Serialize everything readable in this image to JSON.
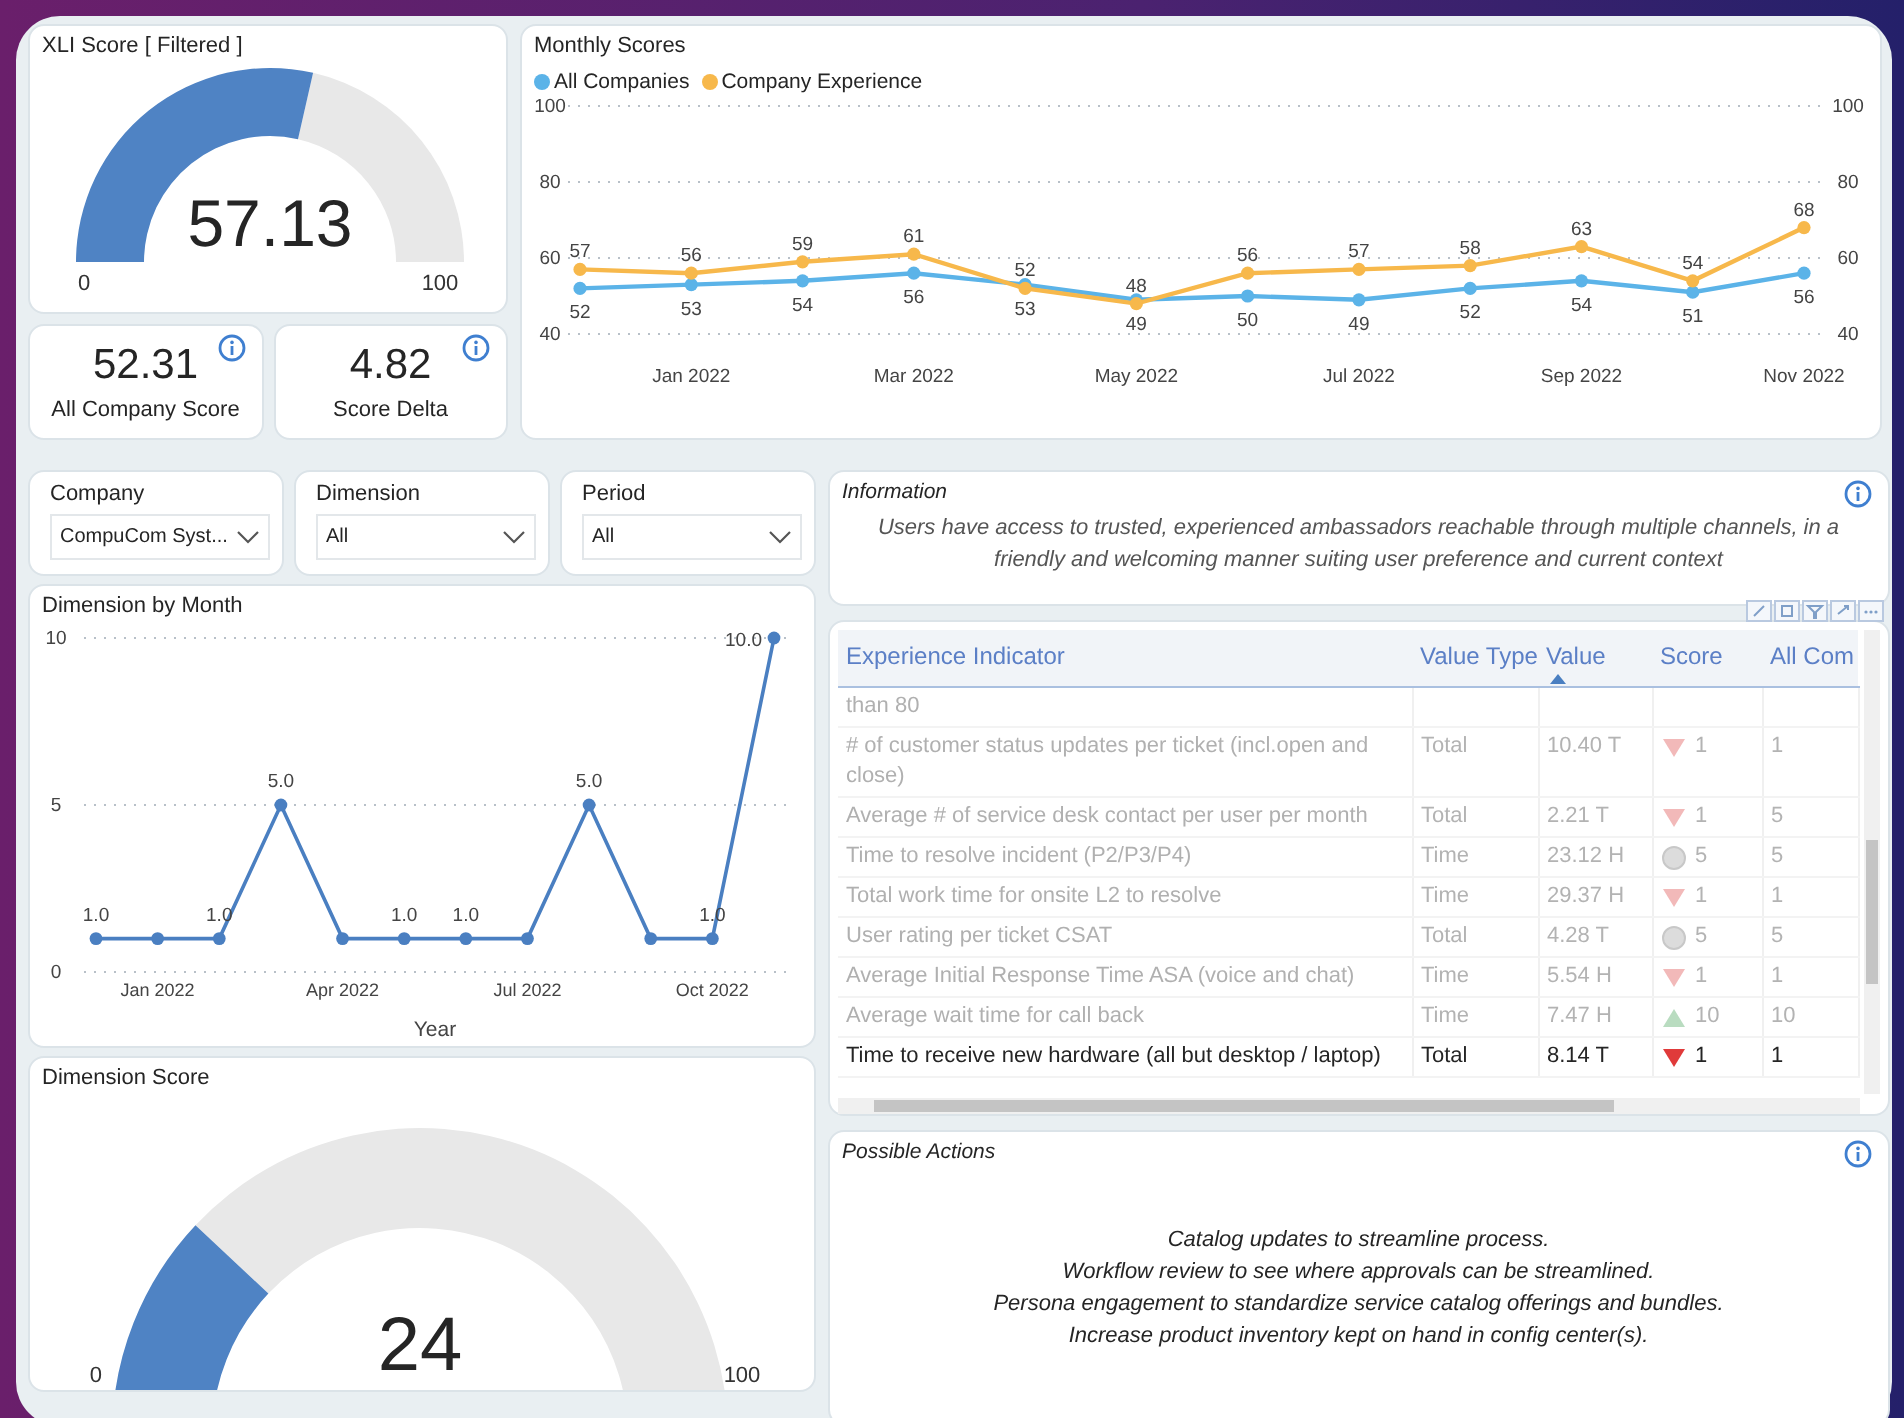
{
  "xli_gauge": {
    "title": "XLI Score [ Filtered ]",
    "value": "57.13",
    "level": 0.5713,
    "min": "0",
    "max": "100"
  },
  "kpis": [
    {
      "value": "52.31",
      "label": "All Company Score"
    },
    {
      "value": "4.82",
      "label": "Score Delta"
    }
  ],
  "monthly_scores": {
    "title": "Monthly Scores",
    "chart_data": {
      "type": "line",
      "categories": [
        null,
        "Jan 2022",
        null,
        "Mar 2022",
        null,
        "May 2022",
        null,
        "Jul 2022",
        null,
        "Sep 2022",
        null,
        "Nov 2022"
      ],
      "ylim": [
        40,
        100
      ],
      "yticks": [
        40,
        60,
        80,
        100
      ],
      "y2lim": [
        40,
        100
      ],
      "y2ticks": [
        40,
        60,
        80,
        100
      ],
      "data_labels": true,
      "series": [
        {
          "name": "All Companies",
          "color": "#5bb3e8",
          "marker": "circle",
          "values": [
            52,
            53,
            54,
            56,
            53,
            49,
            50,
            49,
            52,
            54,
            51,
            56
          ]
        },
        {
          "name": "Company Experience",
          "color": "#f7b84b",
          "marker": "circle",
          "values": [
            57,
            56,
            59,
            61,
            52,
            48,
            56,
            57,
            58,
            63,
            54,
            68
          ]
        }
      ]
    }
  },
  "filters": [
    {
      "label": "Company",
      "value": "CompuCom Syst..."
    },
    {
      "label": "Dimension",
      "value": "All"
    },
    {
      "label": "Period",
      "value": "All"
    }
  ],
  "dimension_by_month": {
    "title": "Dimension by Month",
    "chart_data": {
      "type": "line",
      "xlabel": "Year",
      "categories": [
        null,
        "Jan 2022",
        null,
        null,
        "Apr 2022",
        null,
        null,
        "Jul 2022",
        null,
        null,
        "Oct 2022",
        null
      ],
      "ylim": [
        0,
        10
      ],
      "yticks": [
        0,
        5,
        10
      ],
      "series": [
        {
          "color": "#4a7fc1",
          "marker": "circle",
          "values": [
            1,
            1,
            1,
            5,
            1,
            1,
            1,
            1,
            5,
            1,
            1,
            10
          ]
        }
      ],
      "value_labels": [
        "1.0",
        null,
        "1.0",
        "5.0",
        null,
        "1.0",
        "1.0",
        null,
        "5.0",
        null,
        "1.0",
        "10.0"
      ]
    }
  },
  "dimension_score": {
    "title": "Dimension Score",
    "value": "24",
    "level": 0.24,
    "min": "0",
    "max": "100"
  },
  "information": {
    "title": "Information",
    "text": "Users have access to trusted, experienced ambassadors reachable through multiple channels, in a friendly and welcoming manner suiting user preference and current context"
  },
  "table": {
    "columns": [
      {
        "label": "Experience Indicator",
        "sorted": false
      },
      {
        "label": "Value Type",
        "sorted": false
      },
      {
        "label": "Value",
        "sorted": true
      },
      {
        "label": "Score",
        "sorted": false
      },
      {
        "label": "All Com",
        "sorted": false
      }
    ],
    "rows": [
      {
        "indicator": "than 80",
        "dimmed": true
      },
      {
        "indicator": "# of customer status updates per ticket (incl.open and close)",
        "value_type": "Total",
        "value": "10.40 T",
        "kind": "down",
        "score": "1",
        "all_companies": "1",
        "dimmed": true
      },
      {
        "indicator": "Average # of service desk contact per user per month",
        "value_type": "Total",
        "value": "2.21 T",
        "kind": "down",
        "score": "1",
        "all_companies": "5",
        "dimmed": true
      },
      {
        "indicator": "Time to resolve incident (P2/P3/P4)",
        "value_type": "Time",
        "value": "23.12 H",
        "kind": "flat",
        "score": "5",
        "all_companies": "5",
        "dimmed": true
      },
      {
        "indicator": "Total work time for onsite L2 to resolve",
        "value_type": "Time",
        "value": "29.37 H",
        "kind": "down",
        "score": "1",
        "all_companies": "1",
        "dimmed": true
      },
      {
        "indicator": "User rating per ticket CSAT",
        "value_type": "Total",
        "value": "4.28 T",
        "kind": "flat",
        "score": "5",
        "all_companies": "5",
        "dimmed": true
      },
      {
        "indicator": "Average Initial Response Time ASA (voice and chat)",
        "value_type": "Time",
        "value": "5.54 H",
        "kind": "down",
        "score": "1",
        "all_companies": "1",
        "dimmed": true
      },
      {
        "indicator": "Average wait time for call back",
        "value_type": "Time",
        "value": "7.47 H",
        "kind": "up",
        "score": "10",
        "all_companies": "10",
        "dimmed": true
      },
      {
        "indicator": "Time to receive new hardware (all but desktop / laptop)",
        "value_type": "Total",
        "value": "8.14 T",
        "kind": "down",
        "score": "1",
        "all_companies": "1",
        "dimmed": false
      }
    ]
  },
  "possible_actions": {
    "title": "Possible Actions",
    "lines": [
      "Catalog updates to streamline process.",
      "Workflow review to see where approvals can be streamlined.",
      "Persona engagement to standardize service catalog offerings and bundles.",
      "Increase product inventory kept on hand in config center(s)."
    ]
  }
}
